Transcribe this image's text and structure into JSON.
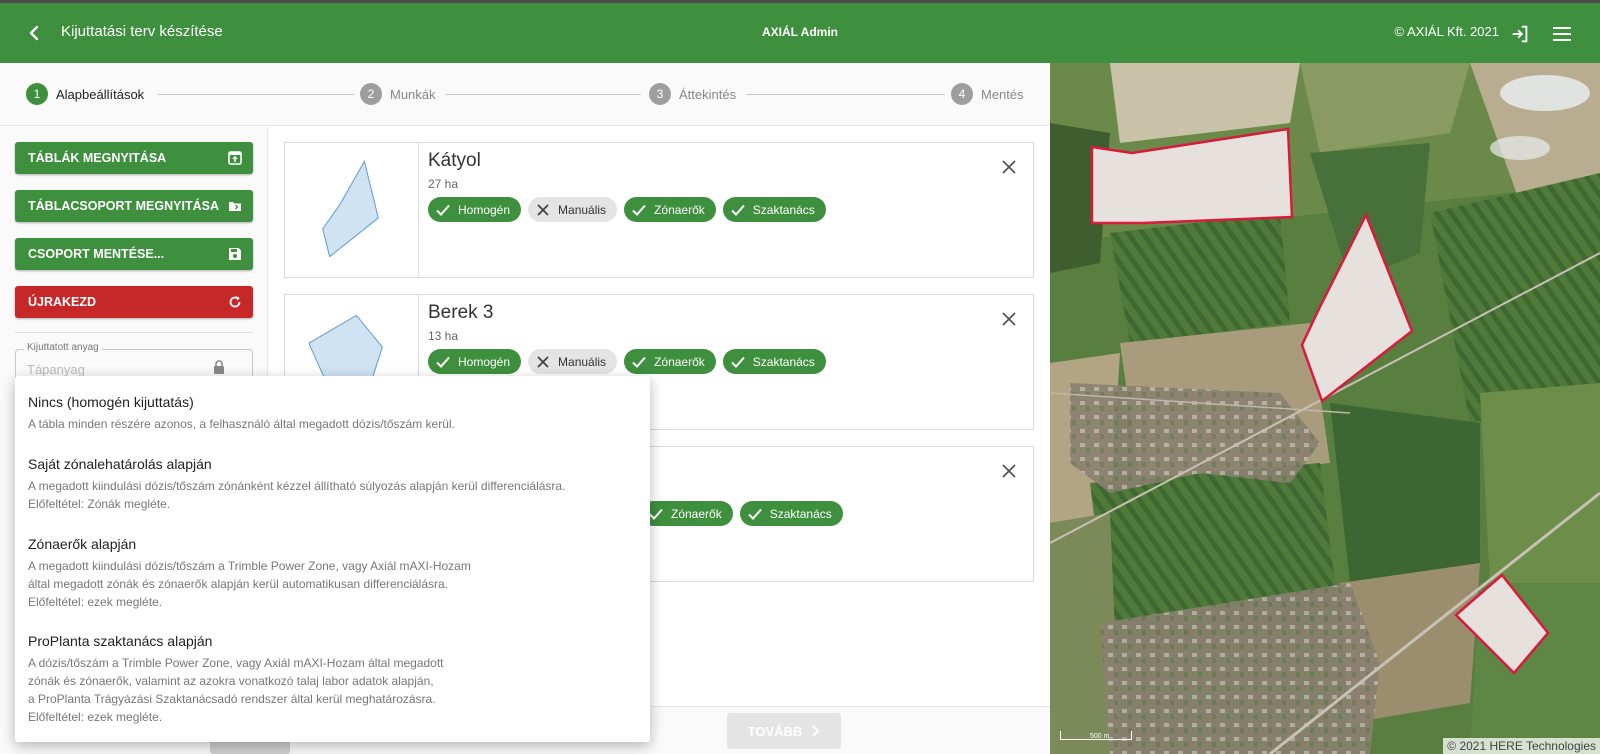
{
  "header": {
    "title": "Kijuttatási terv készítése",
    "center": "AXIÁL Admin",
    "copyright": "© AXIÁL Kft. 2021"
  },
  "stepper": [
    {
      "num": "1",
      "label": "Alapbeállítások"
    },
    {
      "num": "2",
      "label": "Munkák"
    },
    {
      "num": "3",
      "label": "Áttekintés"
    },
    {
      "num": "4",
      "label": "Mentés"
    }
  ],
  "left": {
    "btn_open_tables": "TÁBLÁK MEGNYITÁSA",
    "btn_open_group": "TÁBLACSOPORT MEGNYITÁSA",
    "btn_save_group": "CSOPORT MENTÉSE...",
    "btn_restart": "ÚJRAKEZD",
    "material_label": "Kijuttatott anyag",
    "material_placeholder": "Tápanyag"
  },
  "cards": [
    {
      "name": "Kátyol",
      "area": "27 ha",
      "chips": [
        {
          "label": "Homogén",
          "state": "on"
        },
        {
          "label": "Manuális",
          "state": "off"
        },
        {
          "label": "Zónaerők",
          "state": "on"
        },
        {
          "label": "Szaktanács",
          "state": "on"
        }
      ]
    },
    {
      "name": "Berek 3",
      "area": "13 ha",
      "chips": [
        {
          "label": "Homogén",
          "state": "on"
        },
        {
          "label": "Manuális",
          "state": "off"
        },
        {
          "label": "Zónaerők",
          "state": "on"
        },
        {
          "label": "Szaktanács",
          "state": "on"
        }
      ]
    },
    {
      "chips": [
        {
          "label": "Zónaerők",
          "state": "on"
        },
        {
          "label": "Szaktanács",
          "state": "on"
        }
      ]
    }
  ],
  "dropdown": [
    {
      "title": "Nincs (homogén kijuttatás)",
      "lines": [
        "A tábla minden részére azonos, a felhasználó által megadott dózis/tőszám kerül."
      ]
    },
    {
      "title": "Saját zónalehatárolás alapján",
      "lines": [
        "A megadott kiindulási dózis/tőszám zónánként kézzel állítható súlyozás alapján kerül differenciálásra.",
        "Előfeltétel: Zónák megléte."
      ]
    },
    {
      "title": "Zónaerők alapján",
      "lines": [
        "A megadott kiindulási dózis/tőszám a Trimble Power Zone, vagy Axiál mAXI-Hozam",
        "által megadott zónák és zónaerők alapján kerül automatikusan differenciálásra.",
        "Előfeltétel: ezek megléte."
      ]
    },
    {
      "title": "ProPlanta szaktanács alapján",
      "lines": [
        "A dózis/tőszám a Trimble Power Zone, vagy Axiál mAXI-Hozam által megadott",
        "zónák és zónaerők, valamint az azokra vonatkozó talaj labor adatok alapján,",
        "a ProPlanta Trágyázási Szaktanácsadó rendszer által kerül meghatározásra.",
        "Előfeltétel: ezek megléte."
      ]
    }
  ],
  "footer": {
    "next": "TOVÁBB"
  },
  "map": {
    "scale": "500 m",
    "credit": "© 2021 HERE Technologies"
  },
  "colors": {
    "primary": "#3e8f3e",
    "danger": "#c62828",
    "field_outline": "#d81b3c"
  }
}
